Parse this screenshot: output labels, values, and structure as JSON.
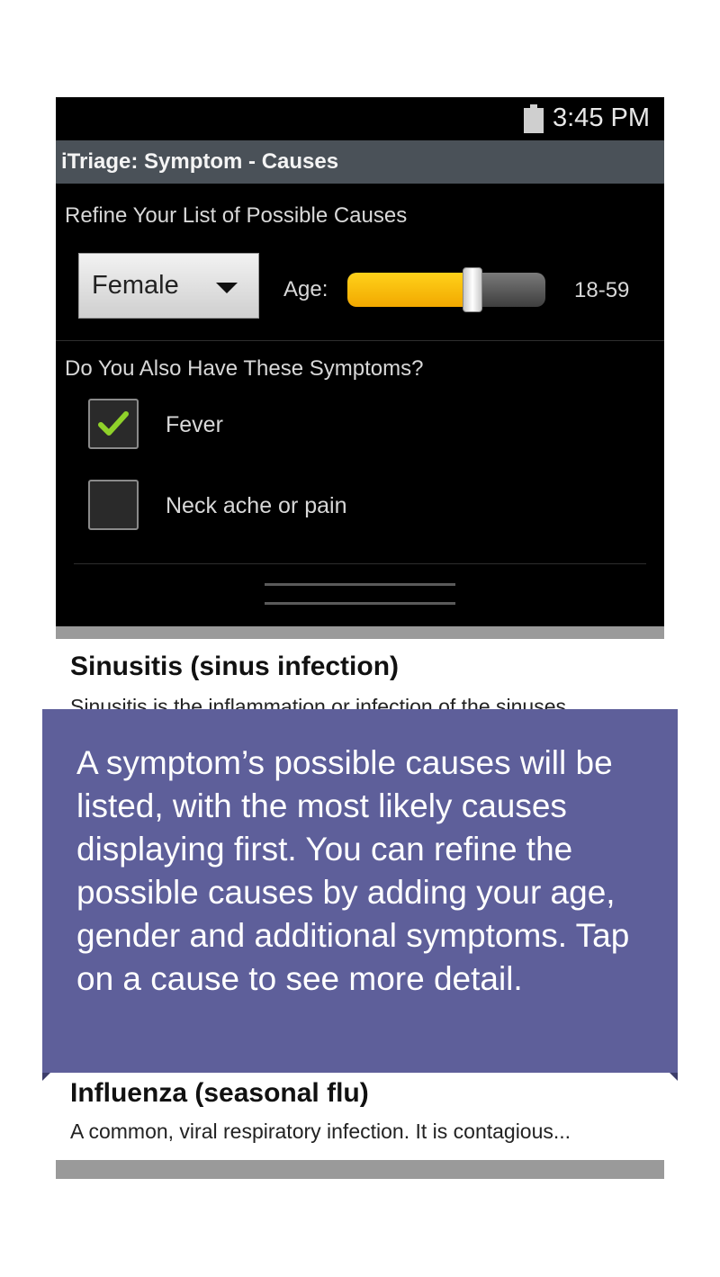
{
  "status_bar": {
    "time": "3:45 PM",
    "battery_icon": "battery-icon"
  },
  "app_bar": {
    "title": "iTriage: Symptom - Causes"
  },
  "refine": {
    "label": "Refine Your List of Possible Causes",
    "gender": {
      "selected": "Female",
      "icon": "chevron-down-icon"
    },
    "age": {
      "label": "Age:",
      "range": "18-59",
      "slider_value_fraction": 0.63
    }
  },
  "symptoms": {
    "label": "Do You Also Have These Symptoms?",
    "items": [
      {
        "label": "Fever",
        "checked": true
      },
      {
        "label": "Neck ache or pain",
        "checked": false
      }
    ]
  },
  "causes": [
    {
      "title": "Sinusitis (sinus infection)",
      "description": "Sinusitis is the inflammation or infection of the sinuses."
    },
    {
      "title": "Influenza (seasonal flu)",
      "description": "A common, viral respiratory infection. It is contagious..."
    }
  ],
  "tutorial": {
    "text": "A symptom’s possible causes will be listed, with the most likely causes displaying first. You can refine the possible causes by adding your age, gender and additional symptoms. Tap on a cause to see more detail."
  },
  "colors": {
    "overlay": "#5e5f9a",
    "accent_slider": "#ffc40d",
    "check": "#8fd12a",
    "title_bar": "#4a5158"
  }
}
